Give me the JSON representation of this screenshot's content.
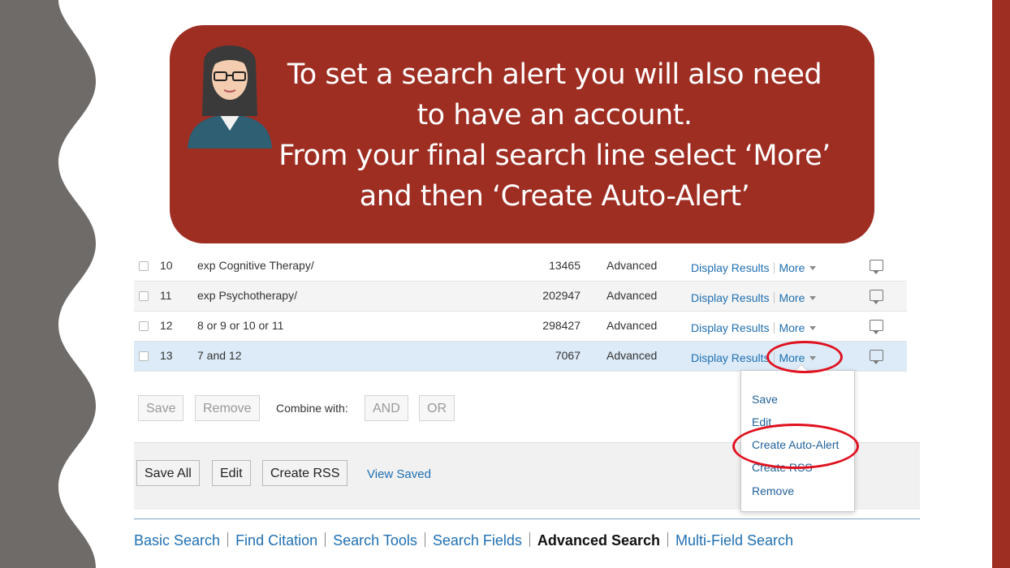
{
  "theme": {
    "accent": "#9e2d22",
    "left_band": "#6e6b69",
    "link": "#1f6fb2",
    "highlight_row": "#dcebf7",
    "annotation_ring": "#e0101e"
  },
  "callout": {
    "lines": [
      "To set a search alert you will also need",
      "to have an account.",
      "From your final search line select ‘More’",
      "and then ‘Create Auto-Alert’"
    ],
    "avatar_icon": "woman-with-glasses-avatar"
  },
  "history": {
    "rows": [
      {
        "num": "10",
        "query": "exp Cognitive Therapy/",
        "count": "13465",
        "type": "Advanced",
        "display": "Display Results",
        "more": "More"
      },
      {
        "num": "11",
        "query": "exp Psychotherapy/",
        "count": "202947",
        "type": "Advanced",
        "display": "Display Results",
        "more": "More"
      },
      {
        "num": "12",
        "query": "8 or 9 or 10 or 11",
        "count": "298427",
        "type": "Advanced",
        "display": "Display Results",
        "more": "More"
      },
      {
        "num": "13",
        "query": "7 and 12",
        "count": "7067",
        "type": "Advanced",
        "display": "Display Results",
        "more": "More"
      }
    ]
  },
  "actions": {
    "save": "Save",
    "remove": "Remove",
    "combine_label": "Combine with:",
    "and": "AND",
    "or": "OR"
  },
  "bottom": {
    "save_all": "Save All",
    "edit": "Edit",
    "create_rss": "Create RSS",
    "view_saved": "View Saved"
  },
  "tabs": [
    "Basic Search",
    "Find Citation",
    "Search Tools",
    "Search Fields",
    "Advanced Search",
    "Multi-Field Search"
  ],
  "active_tab": "Advanced Search",
  "dropdown": {
    "items": [
      "Save",
      "Edit",
      "Create Auto-Alert",
      "Create RSS",
      "Remove"
    ]
  }
}
